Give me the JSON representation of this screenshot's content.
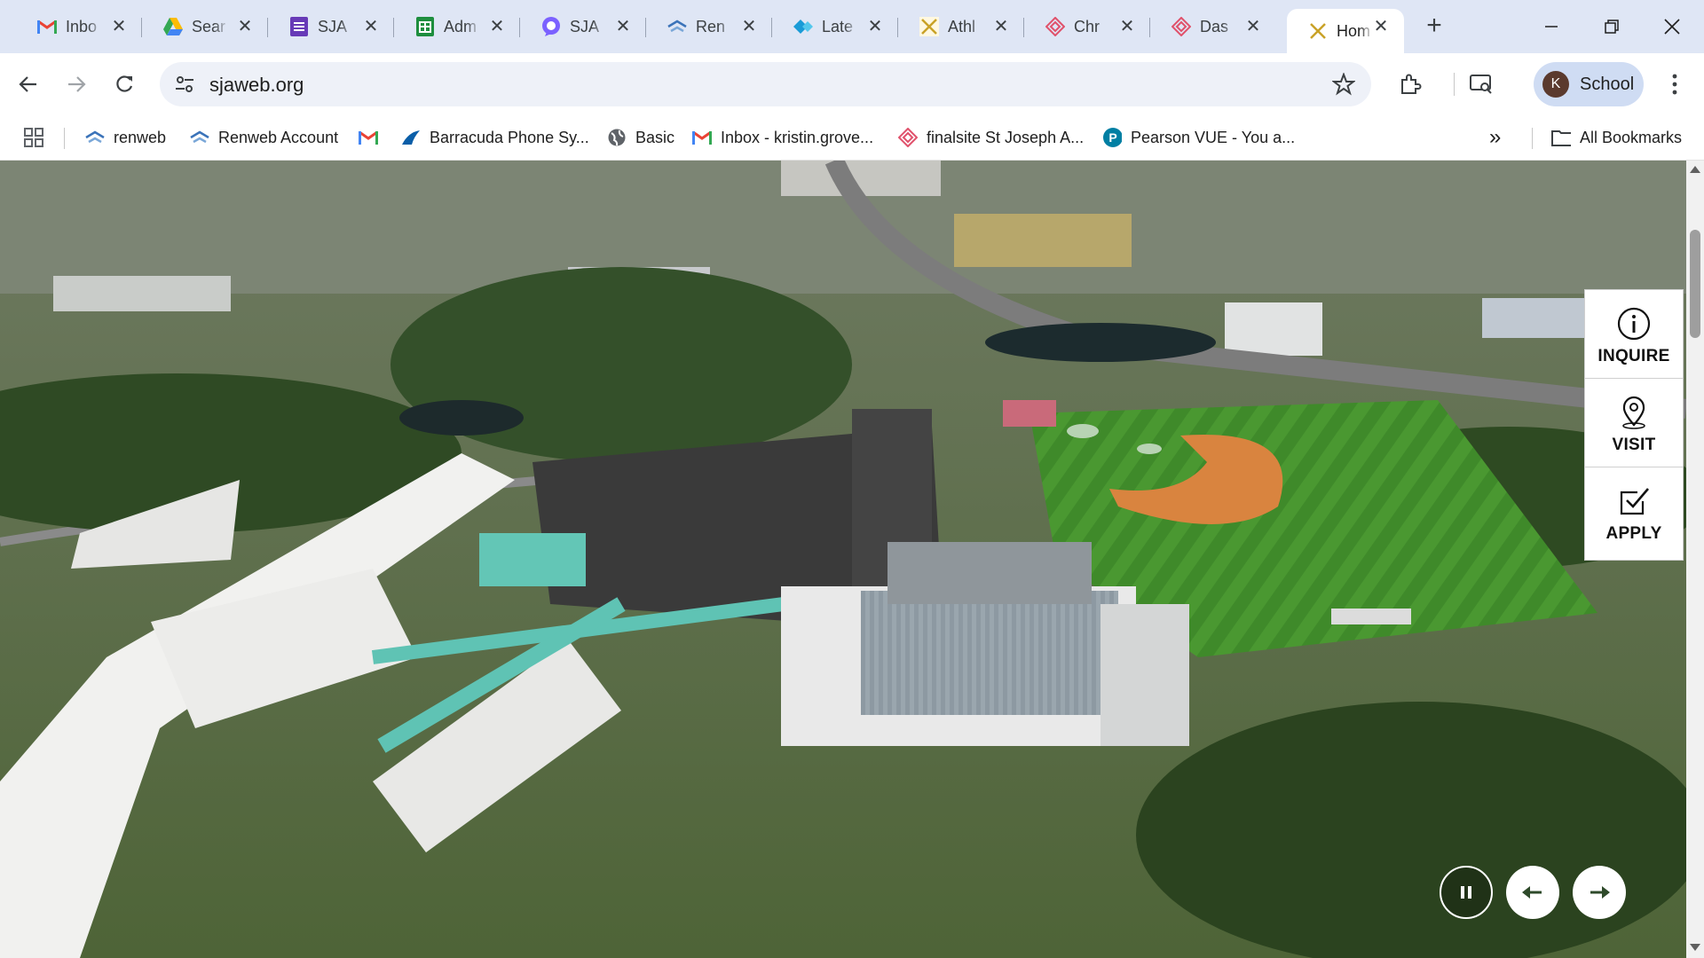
{
  "browser": {
    "tabs": [
      {
        "title": "Inbo",
        "icon": "gmail-icon"
      },
      {
        "title": "Sear",
        "icon": "google-drive-icon"
      },
      {
        "title": "SJA",
        "icon": "google-forms-icon"
      },
      {
        "title": "Adm",
        "icon": "google-sheets-icon"
      },
      {
        "title": "SJA",
        "icon": "chat-icon"
      },
      {
        "title": "Ren",
        "icon": "renweb-icon"
      },
      {
        "title": "Late",
        "icon": "diamond-icon"
      },
      {
        "title": "Athl",
        "icon": "finalsite-x-icon"
      },
      {
        "title": "Chr",
        "icon": "finalsite-icon"
      },
      {
        "title": "Das",
        "icon": "finalsite-icon"
      },
      {
        "title": "Hom",
        "icon": "finalsite-x-icon",
        "active": true
      }
    ],
    "new_tab_label": "+",
    "url": "sjaweb.org",
    "profile": {
      "initial": "K",
      "name": "School"
    }
  },
  "bookmarks": [
    {
      "label": "renweb",
      "icon": "renweb-icon"
    },
    {
      "label": "Renweb Account",
      "icon": "renweb-icon"
    },
    {
      "label": "",
      "icon": "gmail-icon"
    },
    {
      "label": "Barracuda Phone Sy...",
      "icon": "barracuda-icon"
    },
    {
      "label": "Basic",
      "icon": "globe-icon"
    },
    {
      "label": "Inbox - kristin.grove...",
      "icon": "gmail-icon"
    },
    {
      "label": "finalsite St Joseph A...",
      "icon": "finalsite-icon"
    },
    {
      "label": "Pearson VUE - You a...",
      "icon": "pearson-icon"
    }
  ],
  "bookmarks_overflow": "»",
  "all_bookmarks": "All Bookmarks",
  "page": {
    "ctas": [
      {
        "label": "INQUIRE",
        "icon": "info-icon"
      },
      {
        "label": "VISIT",
        "icon": "map-pin-icon"
      },
      {
        "label": "APPLY",
        "icon": "checkbox-icon"
      }
    ],
    "slideshow": {
      "pause": "pause-icon",
      "prev": "arrow-left-icon",
      "next": "arrow-right-icon"
    }
  },
  "colors": {
    "tabstrip": "#dfe6f5",
    "omnibox": "#eef1f8",
    "profile_chip": "#cfdcf3",
    "slider_arrow": "#2e4a2a"
  }
}
